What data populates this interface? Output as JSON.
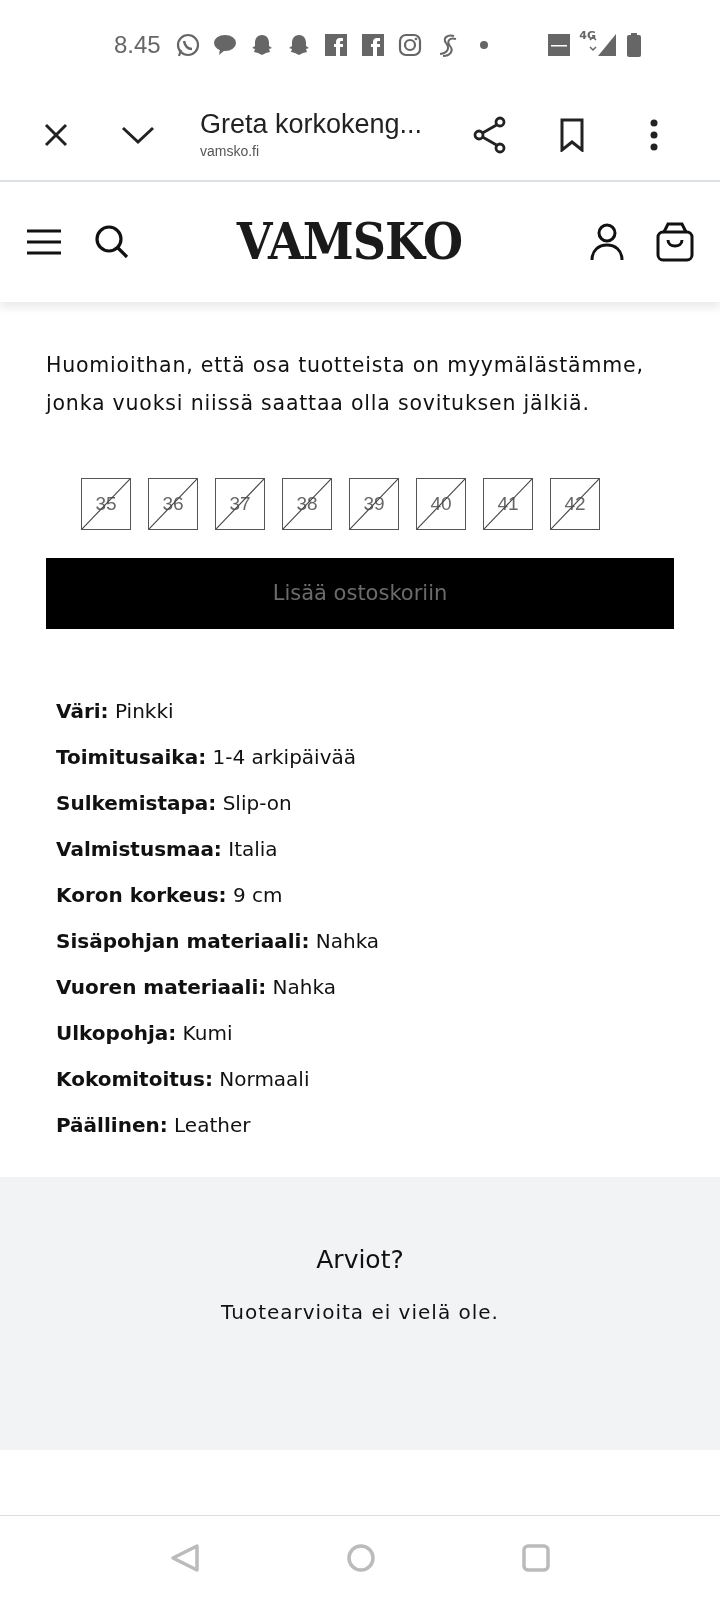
{
  "status_bar": {
    "time": "8.45",
    "notification_icons": [
      {
        "kind": "whatsapp"
      },
      {
        "kind": "messages"
      },
      {
        "kind": "snapchat"
      },
      {
        "kind": "snapchat"
      },
      {
        "kind": "facebook"
      },
      {
        "kind": "facebook"
      },
      {
        "kind": "instagram"
      },
      {
        "kind": "s-app"
      },
      {
        "kind": "dot"
      }
    ],
    "network": "4G"
  },
  "browser_bar": {
    "title": "Greta korkokeng...",
    "url": "vamsko.fi"
  },
  "site_header": {
    "logo": "VAMSKO"
  },
  "notice": "Huomioithan, että osa tuotteista on myymälästämme, jonka vuoksi niissä saattaa olla sovituksen jälkiä.",
  "sizes": [
    {
      "label": "35",
      "available": false
    },
    {
      "label": "36",
      "available": false
    },
    {
      "label": "37",
      "available": false
    },
    {
      "label": "38",
      "available": false
    },
    {
      "label": "39",
      "available": false
    },
    {
      "label": "40",
      "available": false
    },
    {
      "label": "41",
      "available": false
    },
    {
      "label": "42",
      "available": false
    }
  ],
  "add_to_cart": {
    "label": "Lisää ostoskoriin",
    "disabled": true
  },
  "specs": [
    {
      "label": "Väri:",
      "value": "Pinkki"
    },
    {
      "label": "Toimitusaika:",
      "value": "1-4 arkipäivää"
    },
    {
      "label": "Sulkemistapa:",
      "value": "Slip-on"
    },
    {
      "label": "Valmistusmaa:",
      "value": "Italia"
    },
    {
      "label": "Koron korkeus:",
      "value": "9 cm"
    },
    {
      "label": "Sisäpohjan materiaali:",
      "value": "Nahka"
    },
    {
      "label": "Vuoren materiaali:",
      "value": "Nahka"
    },
    {
      "label": "Ulkopohja:",
      "value": "Kumi"
    },
    {
      "label": "Kokomitoitus:",
      "value": "Normaali"
    },
    {
      "label": "Päällinen:",
      "value": "Leather"
    }
  ],
  "reviews": {
    "title": "Arviot?",
    "empty_text": "Tuotearvioita ei vielä ole."
  }
}
